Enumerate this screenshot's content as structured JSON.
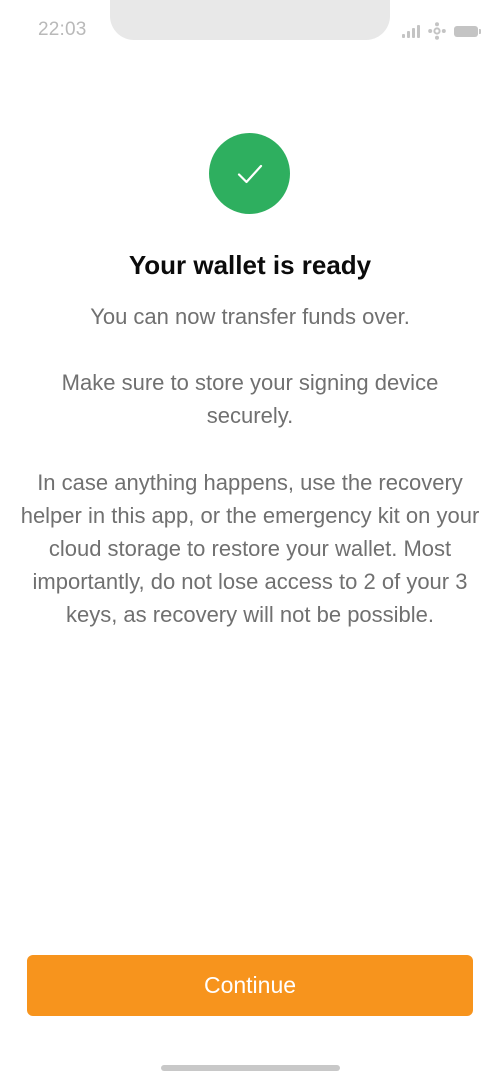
{
  "status_bar": {
    "time": "22:03",
    "icons": [
      "signal-icon",
      "connectivity-icon",
      "battery-icon"
    ]
  },
  "success": {
    "icon": "checkmark-icon",
    "color": "#2eaf5f"
  },
  "content": {
    "title": "Your wallet is ready",
    "paragraph_1": "You can now transfer funds over.",
    "paragraph_2": "Make sure to store your signing device securely.",
    "paragraph_3": "In case anything happens, use the recovery helper in this app, or the emergency kit on your cloud storage to restore your wallet. Most importantly, do not lose access to 2 of your 3 keys, as recovery will not be possible."
  },
  "actions": {
    "continue_label": "Continue",
    "accent_color": "#f7941d"
  }
}
